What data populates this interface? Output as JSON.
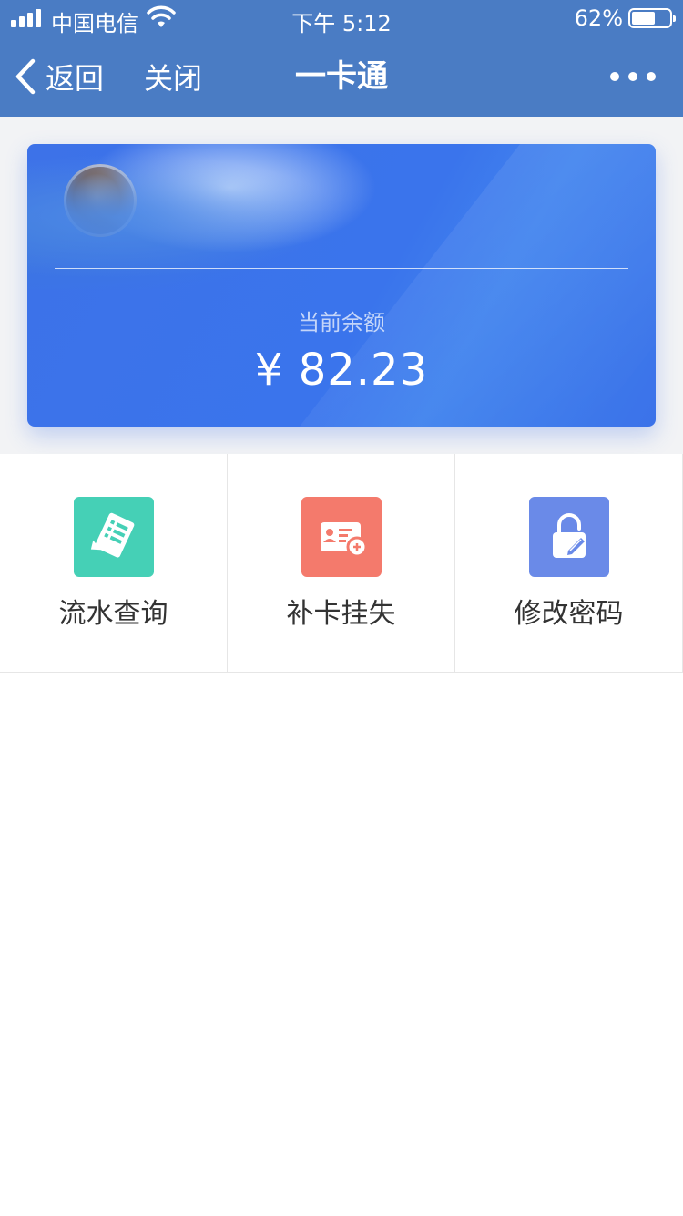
{
  "status_bar": {
    "carrier": "中国电信",
    "time": "下午 5:12",
    "battery_percent": "62%",
    "battery_level": 0.62
  },
  "nav": {
    "back_label": "返回",
    "close_label": "关闭",
    "title": "一卡通"
  },
  "card": {
    "balance_label": "当前余额",
    "balance_value": "¥ 82.23"
  },
  "menu": {
    "items": [
      {
        "label": "流水查询",
        "icon": "transaction-list-icon",
        "color": "#45d0b6"
      },
      {
        "label": "补卡挂失",
        "icon": "card-replace-icon",
        "color": "#f47a6c"
      },
      {
        "label": "修改密码",
        "icon": "lock-edit-icon",
        "color": "#6a8ae8"
      }
    ]
  },
  "colors": {
    "header": "#4a7cc4",
    "card": "#3d72e8",
    "background": "#f2f3f5"
  }
}
